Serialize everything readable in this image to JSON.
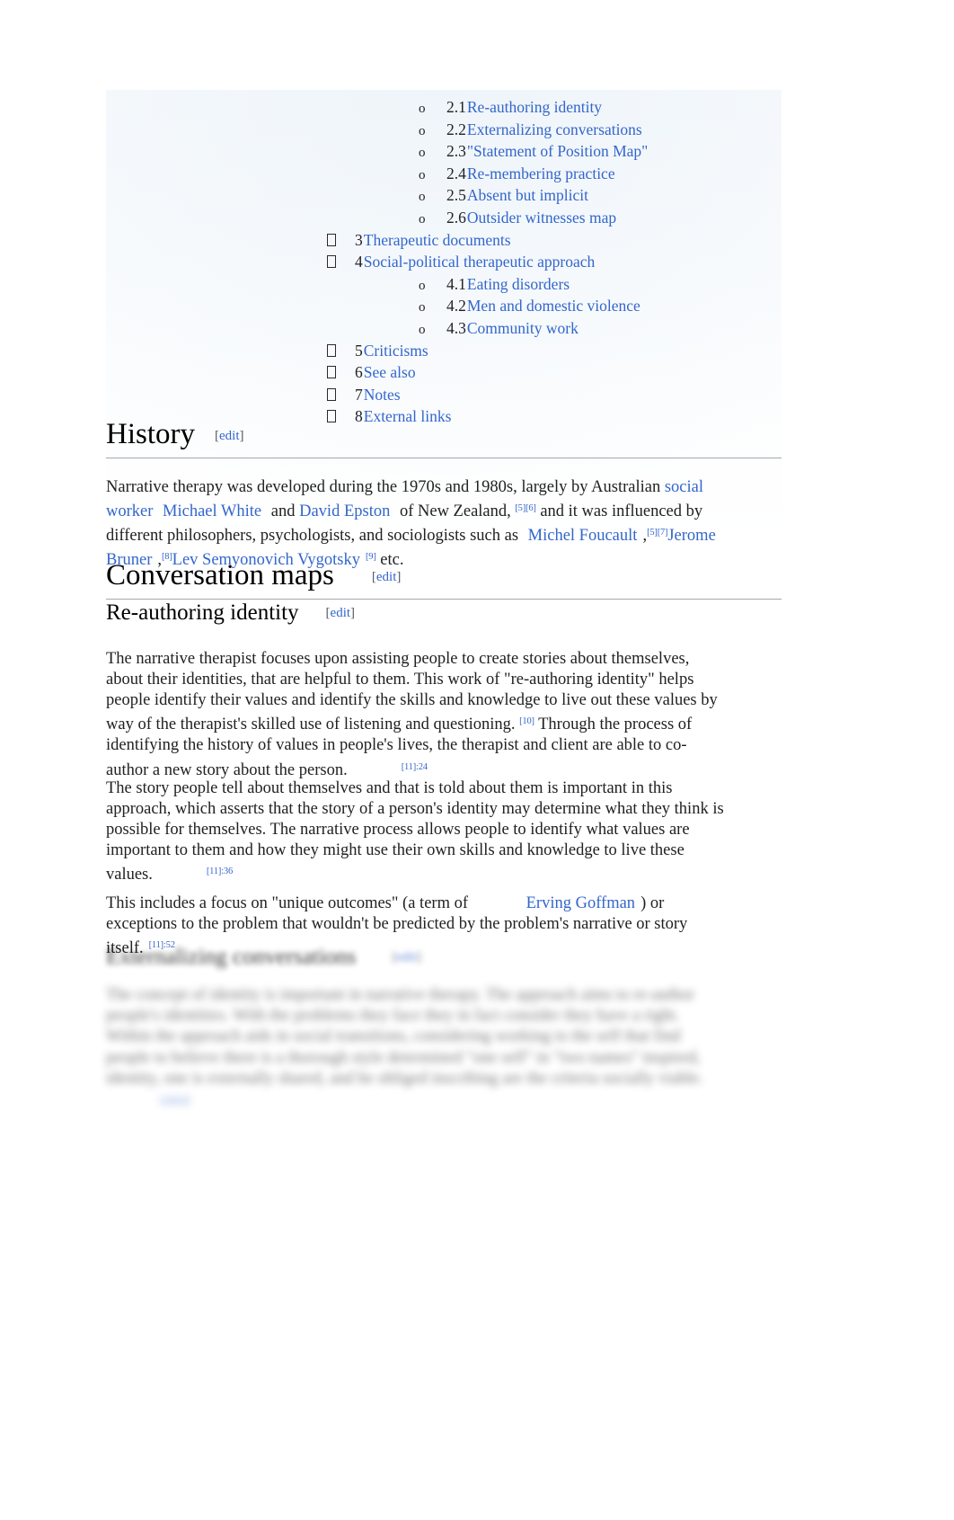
{
  "colors": {
    "link": "#3366cc",
    "text": "#202122",
    "rule": "#a2a9b1",
    "edit": "#54595d"
  },
  "toc": {
    "items": [
      {
        "level": 2,
        "marker": "o",
        "number": "2.1",
        "label": "Re-authoring identity"
      },
      {
        "level": 2,
        "marker": "o",
        "number": "2.2",
        "label": "Externalizing conversations"
      },
      {
        "level": 2,
        "marker": "o",
        "number": "2.3",
        "label": "\"Statement of Position Map\""
      },
      {
        "level": 2,
        "marker": "o",
        "number": "2.4",
        "label": "Re-membering practice"
      },
      {
        "level": 2,
        "marker": "o",
        "number": "2.5",
        "label": "Absent but implicit"
      },
      {
        "level": 2,
        "marker": "o",
        "number": "2.6",
        "label": "Outsider witnesses map"
      },
      {
        "level": 1,
        "marker": "tofu",
        "number": "3",
        "label": "Therapeutic documents"
      },
      {
        "level": 1,
        "marker": "tofu",
        "number": "4",
        "label": "Social-political therapeutic approach"
      },
      {
        "level": 2,
        "marker": "o",
        "number": "4.1",
        "label": "Eating disorders"
      },
      {
        "level": 2,
        "marker": "o",
        "number": "4.2",
        "label": "Men and domestic violence"
      },
      {
        "level": 2,
        "marker": "o",
        "number": "4.3",
        "label": "Community work"
      },
      {
        "level": 1,
        "marker": "tofu",
        "number": "5",
        "label": "Criticisms"
      },
      {
        "level": 1,
        "marker": "tofu",
        "number": "6",
        "label": "See also"
      },
      {
        "level": 1,
        "marker": "tofu",
        "number": "7",
        "label": "Notes"
      },
      {
        "level": 1,
        "marker": "tofu",
        "number": "8",
        "label": "External links"
      }
    ]
  },
  "history": {
    "heading": "History",
    "edit_open": "[",
    "edit_label": "edit",
    "edit_close": "]",
    "p1": {
      "t1": "Narrative therapy was developed during the 1970s and 1980s, largely by Australian ",
      "link1": "social worker",
      "t2": " ",
      "link2": "Michael White",
      "t3": " and ",
      "link3": "David Epston",
      "t4": " of New Zealand, ",
      "cite1": "[5][6]",
      "t5": " and it was influenced by different philosophers, psychologists, and sociologists such as ",
      "link4": "Michel Foucault",
      "t6": ",",
      "cite2": "[5][7]",
      "link5": "Jerome Bruner",
      "t7": ",",
      "cite3": "[8]",
      "link6": "Lev Semyonovich Vygotsky",
      "cite4": "[9]",
      "t8": " etc."
    }
  },
  "conversation_maps": {
    "heading": "Conversation maps",
    "edit_open": "[",
    "edit_label": "edit",
    "edit_close": "]"
  },
  "reauthoring": {
    "heading": "Re-authoring identity",
    "edit_open": "[",
    "edit_label": "edit",
    "edit_close": "]",
    "p1": {
      "t1": "The narrative therapist focuses upon assisting people to create stories about themselves, about their identities, that are helpful to them. This work of \"re-authoring identity\" helps people identify their values and identify the skills and knowledge to live out these values by way of the therapist's skilled use of listening and questioning. ",
      "cite1": "[10]",
      "t2": " Through the process of identifying the history of values in people's lives, the therapist and client are able to co-author a new story about the person.",
      "cite2": "[11]:24"
    },
    "p2": {
      "t1": "The story people tell about themselves and that is told about them is important in this approach, which asserts that the story of a person's identity may determine what they think is possible for themselves. The narrative process allows people to identify what values are important to them and how they might use their own skills and knowledge to live these values.",
      "cite1": "[11]:36"
    },
    "p3": {
      "t1": "This includes a focus on \"unique outcomes\" (a term of ",
      "link1": "Erving Goffman",
      "t2": ") or exceptions to the problem that wouldn't be predicted by the problem's narrative or story itself.",
      "cite1": "[11]:52"
    }
  },
  "externalizing": {
    "heading": "Externalizing conversations",
    "edit_open": "[",
    "edit_label": "edit",
    "edit_close": "]",
    "p1": {
      "t1": "The concept of identity is important in narrative therapy. The approach aims to re-author people's identities. With the problems they face they in fact consider they have a right. Within the approach aids in social transitions, considering working to the self that find people to believe there is a thorough style determined \"one self\" in \"two names\" inspired, identity, one is externally shared, and he obliged inscribing are the criteria socially viable.",
      "cite1": "[12][13]"
    }
  }
}
